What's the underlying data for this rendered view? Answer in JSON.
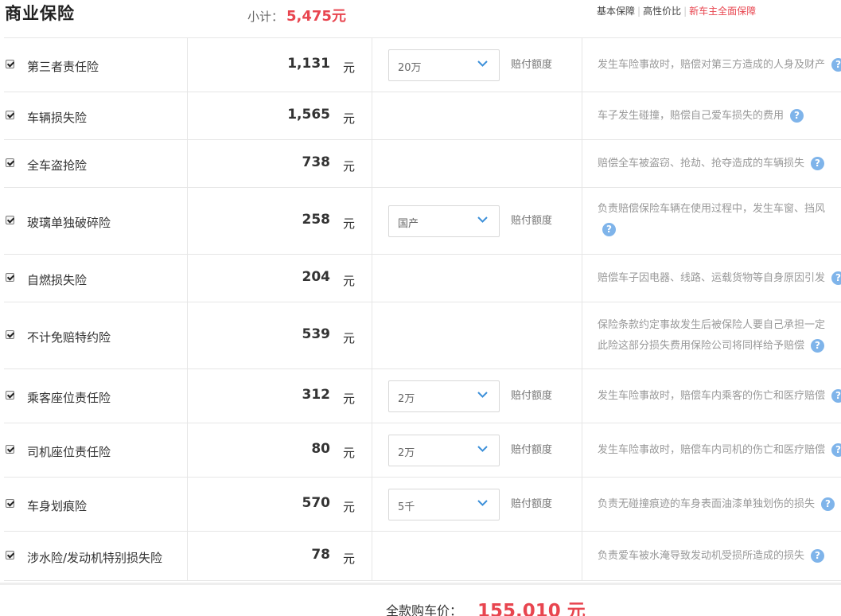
{
  "header": {
    "title": "商业保险",
    "subtotal_label": "小计：",
    "subtotal_value": "5,475元",
    "links": [
      "基本保障",
      "高性价比",
      "新车主全面保障"
    ]
  },
  "rows": [
    {
      "name": "第三者责任险",
      "price": "1,131",
      "unit": "元",
      "select": "20万",
      "amount_label": "赔付额度",
      "desc": [
        "发生车险事故时，赔偿对第三方造成的人身及财产"
      ],
      "checked": true
    },
    {
      "name": "车辆损失险",
      "price": "1,565",
      "unit": "元",
      "desc": [
        "车子发生碰撞，赔偿自己爱车损失的费用"
      ],
      "checked": true
    },
    {
      "name": "全车盗抢险",
      "price": "738",
      "unit": "元",
      "desc": [
        "赔偿全车被盗窃、抢劫、抢夺造成的车辆损失"
      ],
      "checked": true
    },
    {
      "name": "玻璃单独破碎险",
      "price": "258",
      "unit": "元",
      "select": "国产",
      "amount_label": "赔付额度",
      "desc": [
        "负责赔偿保险车辆在使用过程中，发生车窗、挡风"
      ],
      "checked": true
    },
    {
      "name": "自燃损失险",
      "price": "204",
      "unit": "元",
      "desc": [
        "赔偿车子因电器、线路、运载货物等自身原因引发"
      ],
      "checked": true
    },
    {
      "name": "不计免赔特约险",
      "price": "539",
      "unit": "元",
      "desc": [
        "保险条款约定事故发生后被保险人要自己承担一定",
        "此险这部分损失费用保险公司将同样给予赔偿"
      ],
      "checked": true
    },
    {
      "name": "乘客座位责任险",
      "price": "312",
      "unit": "元",
      "select": "2万",
      "amount_label": "赔付额度",
      "desc": [
        "发生车险事故时，赔偿车内乘客的伤亡和医疗赔偿"
      ],
      "checked": true
    },
    {
      "name": "司机座位责任险",
      "price": "80",
      "unit": "元",
      "select": "2万",
      "amount_label": "赔付额度",
      "desc": [
        "发生车险事故时，赔偿车内司机的伤亡和医疗赔偿"
      ],
      "checked": true
    },
    {
      "name": "车身划痕险",
      "price": "570",
      "unit": "元",
      "select": "5千",
      "amount_label": "赔付额度",
      "desc": [
        "负责无碰撞痕迹的车身表面油漆单独划伤的损失"
      ],
      "checked": true
    },
    {
      "name": "涉水险/发动机特别损失险",
      "price": "78",
      "unit": "元",
      "desc": [
        "负责爱车被水淹导致发动机受损所造成的损失"
      ],
      "checked": true
    }
  ],
  "footer": {
    "total_label": "全款购车价：",
    "total_value": "155,010 元"
  },
  "colors": {
    "accent": "#e8454f",
    "help": "#7fb4ea"
  },
  "icons": {
    "help": "question-mark-icon",
    "dropdown": "chevron-down-icon",
    "checkbox": "checkbox-checked-icon"
  }
}
